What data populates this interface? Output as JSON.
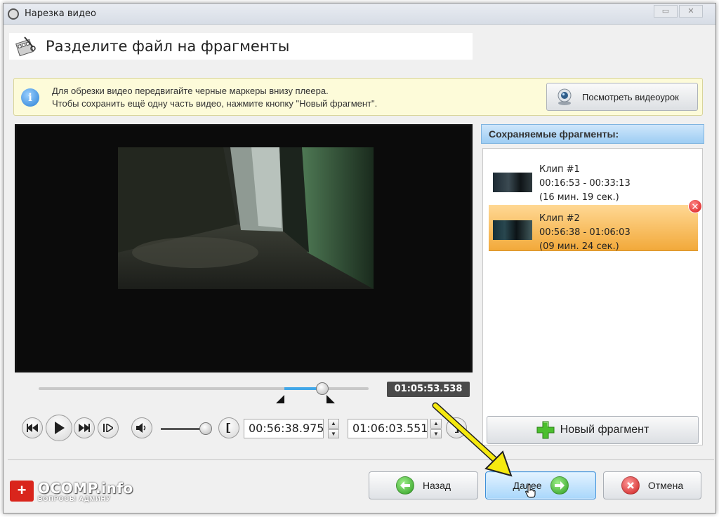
{
  "window": {
    "title": "Нарезка видео",
    "controls": [
      "▭",
      "✕"
    ]
  },
  "header": {
    "title": "Разделите файл на фрагменты"
  },
  "info": {
    "line1": "Для обрезки видео передвигайте черные маркеры внизу плеера.",
    "line2": "Чтобы сохранить ещё одну часть видео, нажмите кнопку \"Новый фрагмент\".",
    "tutorial_button": "Посмотреть видеоурок"
  },
  "player": {
    "current_time": "01:05:53.538",
    "timeline_position": 0.86,
    "selection_start": 0.745,
    "selection_end": 0.868,
    "volume_level": 0.85,
    "start_time": "00:56:38.975",
    "end_time": "01:06:03.551"
  },
  "fragments": {
    "header": "Сохраняемые фрагменты:",
    "items": [
      {
        "name": "Клип #1",
        "range": "00:16:53 - 00:33:13",
        "duration": "(16 мин. 19 сек.)",
        "selected": false
      },
      {
        "name": "Клип #2",
        "range": "00:56:38 - 01:06:03",
        "duration": "(09 мин. 24 сек.)",
        "selected": true
      }
    ],
    "delete_glyph": "✕",
    "new_fragment_button": "Новый фрагмент"
  },
  "footer": {
    "back_button": "Назад",
    "next_button": "Далее",
    "cancel_button": "Отмена"
  },
  "watermark": {
    "badge": "+",
    "main": "OCOMP.info",
    "sub": "ВОПРОСЫ АДМИНУ"
  },
  "colors": {
    "accent_blue": "#41a7e8",
    "selected_item": "#f2a93a",
    "info_bg": "#fdfbd9",
    "arrow_yellow": "#f5e90f"
  },
  "icons": {
    "info": "info-icon",
    "tutorial": "webcam-icon",
    "header": "film-scissors-icon",
    "new_fragment": "plus-icon",
    "back": "arrow-left-icon",
    "next": "arrow-right-icon",
    "cancel": "close-icon"
  }
}
